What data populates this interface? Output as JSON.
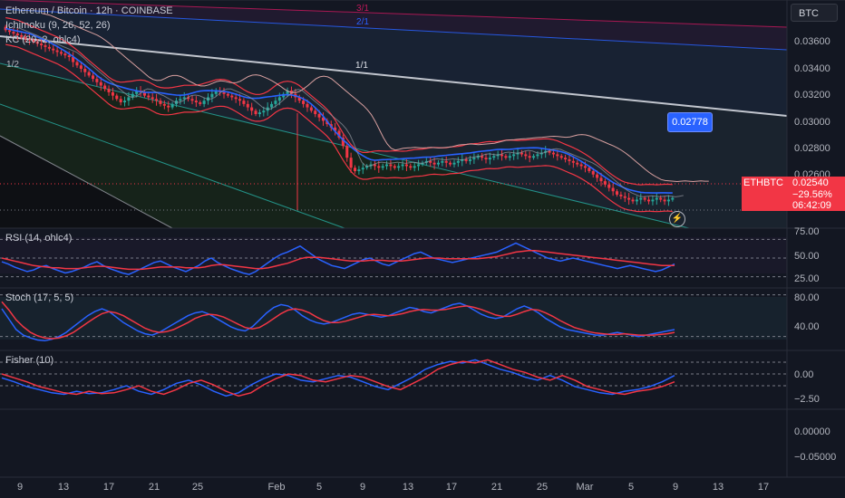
{
  "header": {
    "symbol_line": "Ethereum / Bitcoin · 12h · COINBASE",
    "ichimoku": "Ichimoku (9, 26, 52, 26)",
    "kc": "KC (20, 2, ohlc4)",
    "unit_button": "BTC"
  },
  "price_tag": {
    "symbol": "ETHBTC",
    "price": "0.02540",
    "change": "−29.56%",
    "countdown": "06:42:09"
  },
  "tooltip_value": "0.02778",
  "colors": {
    "background": "#131722",
    "up": "#26a69a",
    "down": "#f23645",
    "blue": "#2962ff",
    "red": "#f23645"
  },
  "chart_data": [
    {
      "type": "candlestick",
      "symbol": "ETHBTC",
      "y_ticks": [
        "0.03600",
        "0.03400",
        "0.03200",
        "0.03000",
        "0.02800",
        "0.02600"
      ],
      "ylim": [
        0.0236,
        0.0372
      ],
      "fan_labels": [
        "3/1",
        "2/1",
        "1/1",
        "1/2"
      ],
      "x_ticks": [
        "9",
        "13",
        "17",
        "21",
        "25",
        "Feb",
        "5",
        "9",
        "13",
        "17",
        "21",
        "25",
        "Mar",
        "5",
        "9",
        "13",
        "17"
      ],
      "close": [
        0.0354,
        0.0353,
        0.0352,
        0.0351,
        0.035,
        0.0349,
        0.0348,
        0.0347,
        0.0346,
        0.0345,
        0.0344,
        0.0343,
        0.0342,
        0.0341,
        0.034,
        0.0339,
        0.0338,
        0.0335,
        0.0333,
        0.0331,
        0.0329,
        0.0327,
        0.0325,
        0.0323,
        0.0321,
        0.0319,
        0.0317,
        0.0315,
        0.0313,
        0.0311,
        0.0312,
        0.0314,
        0.0316,
        0.0318,
        0.0317,
        0.0315,
        0.0314,
        0.0313,
        0.0312,
        0.031,
        0.0309,
        0.0308,
        0.031,
        0.0312,
        0.0313,
        0.0314,
        0.0313,
        0.0312,
        0.0311,
        0.031,
        0.0312,
        0.0314,
        0.0316,
        0.0318,
        0.0317,
        0.0316,
        0.0315,
        0.0314,
        0.0313,
        0.0312,
        0.031,
        0.0308,
        0.0306,
        0.0304,
        0.0305,
        0.0306,
        0.0308,
        0.031,
        0.0312,
        0.0314,
        0.0316,
        0.0318,
        0.0316,
        0.0314,
        0.0312,
        0.031,
        0.0308,
        0.0306,
        0.0304,
        0.0302,
        0.03,
        0.0298,
        0.0296,
        0.0294,
        0.029,
        0.0285,
        0.0278,
        0.0272,
        0.027,
        0.0271,
        0.0272,
        0.0273,
        0.0274,
        0.0273,
        0.0272,
        0.0273,
        0.0274,
        0.0273,
        0.0272,
        0.0273,
        0.0274,
        0.0273,
        0.0272,
        0.0273,
        0.0274,
        0.0275,
        0.0276,
        0.0275,
        0.0274,
        0.0275,
        0.0276,
        0.0275,
        0.0274,
        0.0275,
        0.0276,
        0.0277,
        0.0276,
        0.0277,
        0.0278,
        0.0279,
        0.0278,
        0.0277,
        0.0278,
        0.0279,
        0.028,
        0.0279,
        0.0278,
        0.0279,
        0.028,
        0.0281,
        0.028,
        0.0279,
        0.0278,
        0.0279,
        0.028,
        0.0281,
        0.0282,
        0.0281,
        0.028,
        0.0279,
        0.0278,
        0.0277,
        0.0276,
        0.0275,
        0.0274,
        0.0273,
        0.0272,
        0.027,
        0.0268,
        0.0266,
        0.0264,
        0.0262,
        0.026,
        0.0258,
        0.0256,
        0.0255,
        0.0254,
        0.0253,
        0.0252,
        0.0253,
        0.0254,
        0.0253,
        0.0252,
        0.0253,
        0.0254,
        0.0253,
        0.0252,
        0.0253,
        0.0254
      ]
    },
    {
      "type": "line",
      "name": "RSI (14, ohlc4)",
      "y_ticks": [
        "75.00",
        "50.00",
        "25.00"
      ],
      "series": [
        {
          "name": "RSI",
          "color": "#2962ff",
          "values": [
            45,
            42,
            38,
            35,
            32,
            34,
            38,
            40,
            36,
            33,
            30,
            32,
            35,
            38,
            42,
            45,
            40,
            36,
            33,
            30,
            28,
            32,
            36,
            40,
            44,
            46,
            42,
            38,
            35,
            32,
            36,
            40,
            46,
            50,
            44,
            40,
            36,
            33,
            30,
            28,
            32,
            38,
            44,
            50,
            55,
            58,
            62,
            66,
            60,
            54,
            48,
            44,
            40,
            38,
            36,
            40,
            44,
            48,
            50,
            46,
            42,
            40,
            44,
            48,
            52,
            56,
            58,
            54,
            50,
            48,
            46,
            44,
            46,
            48,
            50,
            52,
            54,
            56,
            58,
            62,
            66,
            70,
            66,
            62,
            58,
            54,
            50,
            48,
            46,
            48,
            50,
            48,
            46,
            44,
            42,
            40,
            38,
            36,
            38,
            40,
            38,
            36,
            34,
            32,
            34,
            38,
            42
          ]
        },
        {
          "name": "Signal",
          "color": "#f23645",
          "values": [
            50,
            48,
            46,
            44,
            42,
            40,
            39,
            38,
            37,
            37,
            36,
            36,
            36,
            37,
            38,
            39,
            39,
            38,
            37,
            36,
            35,
            35,
            35,
            36,
            37,
            38,
            38,
            38,
            38,
            37,
            37,
            37,
            38,
            40,
            41,
            41,
            40,
            39,
            38,
            37,
            36,
            36,
            37,
            39,
            41,
            43,
            46,
            49,
            51,
            51,
            51,
            50,
            49,
            48,
            47,
            46,
            46,
            46,
            47,
            47,
            47,
            46,
            46,
            46,
            47,
            48,
            49,
            50,
            50,
            50,
            49,
            49,
            49,
            49,
            49,
            49,
            50,
            51,
            52,
            54,
            56,
            58,
            59,
            60,
            60,
            59,
            58,
            57,
            56,
            55,
            54,
            53,
            52,
            51,
            50,
            49,
            48,
            47,
            46,
            45,
            44,
            43,
            42,
            41,
            40,
            40,
            40
          ]
        }
      ]
    },
    {
      "type": "line",
      "name": "Stoch (17, 5, 5)",
      "y_ticks": [
        "80.00",
        "40.00"
      ],
      "series": [
        {
          "name": "%K",
          "color": "#2962ff",
          "values": [
            60,
            45,
            30,
            22,
            18,
            15,
            14,
            16,
            20,
            26,
            34,
            42,
            50,
            56,
            60,
            56,
            48,
            40,
            34,
            28,
            24,
            22,
            26,
            32,
            38,
            44,
            50,
            54,
            56,
            52,
            46,
            40,
            34,
            30,
            28,
            34,
            44,
            54,
            62,
            66,
            64,
            58,
            50,
            44,
            40,
            38,
            40,
            44,
            48,
            52,
            54,
            52,
            50,
            48,
            50,
            54,
            58,
            62,
            60,
            56,
            54,
            58,
            62,
            66,
            68,
            64,
            58,
            52,
            48,
            46,
            48,
            54,
            60,
            64,
            60,
            54,
            46,
            40,
            34,
            30,
            28,
            26,
            24,
            22,
            22,
            24,
            26,
            24,
            22,
            20,
            22,
            24,
            26,
            28,
            30
          ]
        },
        {
          "name": "%D",
          "color": "#f23645",
          "values": [
            70,
            58,
            44,
            34,
            26,
            21,
            18,
            17,
            18,
            21,
            26,
            33,
            40,
            47,
            53,
            56,
            54,
            50,
            44,
            38,
            32,
            28,
            26,
            27,
            30,
            35,
            40,
            46,
            50,
            52,
            51,
            48,
            43,
            38,
            33,
            31,
            33,
            39,
            46,
            53,
            58,
            60,
            58,
            54,
            48,
            43,
            40,
            40,
            42,
            45,
            48,
            51,
            52,
            51,
            50,
            51,
            53,
            56,
            58,
            59,
            58,
            58,
            59,
            61,
            63,
            64,
            62,
            59,
            55,
            51,
            49,
            49,
            52,
            56,
            59,
            58,
            54,
            49,
            43,
            38,
            33,
            30,
            27,
            25,
            24,
            23,
            23,
            24,
            23,
            22,
            22,
            22,
            23,
            24,
            26
          ]
        }
      ]
    },
    {
      "type": "line",
      "name": "Fisher (10)",
      "y_ticks": [
        "0.00",
        "−2.50"
      ],
      "series": [
        {
          "name": "Fisher",
          "color": "#2962ff",
          "values": [
            -0.5,
            -1.0,
            -1.6,
            -2.0,
            -2.4,
            -2.6,
            -2.2,
            -2.5,
            -2.4,
            -2.0,
            -1.5,
            -2.2,
            -2.6,
            -2.0,
            -1.2,
            -0.8,
            -1.4,
            -2.2,
            -2.8,
            -2.4,
            -1.4,
            -0.6,
            0.0,
            -0.2,
            -0.8,
            -1.0,
            -0.6,
            -0.2,
            -0.4,
            -1.0,
            -1.6,
            -2.0,
            -1.2,
            -0.4,
            0.6,
            1.2,
            1.6,
            1.4,
            1.8,
            1.2,
            0.6,
            0.2,
            -0.4,
            -0.8,
            -0.2,
            -0.8,
            -1.6,
            -2.0,
            -2.4,
            -2.6,
            -2.2,
            -2.0,
            -1.6,
            -1.0,
            -0.2
          ]
        },
        {
          "name": "Trigger",
          "color": "#f23645",
          "values": [
            0.0,
            -0.5,
            -1.0,
            -1.6,
            -2.0,
            -2.4,
            -2.6,
            -2.2,
            -2.5,
            -2.4,
            -2.0,
            -1.5,
            -2.2,
            -2.6,
            -2.0,
            -1.2,
            -0.8,
            -1.4,
            -2.2,
            -2.8,
            -2.4,
            -1.4,
            -0.6,
            0.0,
            -0.2,
            -0.8,
            -1.0,
            -0.6,
            -0.2,
            -0.4,
            -1.0,
            -1.6,
            -2.0,
            -1.2,
            -0.4,
            0.6,
            1.2,
            1.6,
            1.4,
            1.8,
            1.2,
            0.6,
            0.2,
            -0.4,
            -0.8,
            -0.2,
            -0.8,
            -1.6,
            -2.0,
            -2.4,
            -2.6,
            -2.2,
            -2.0,
            -1.6,
            -1.0
          ]
        }
      ]
    },
    {
      "type": "line",
      "name": "unlabeled pane",
      "y_ticks": [
        "0.00000",
        "−0.05000"
      ]
    }
  ]
}
